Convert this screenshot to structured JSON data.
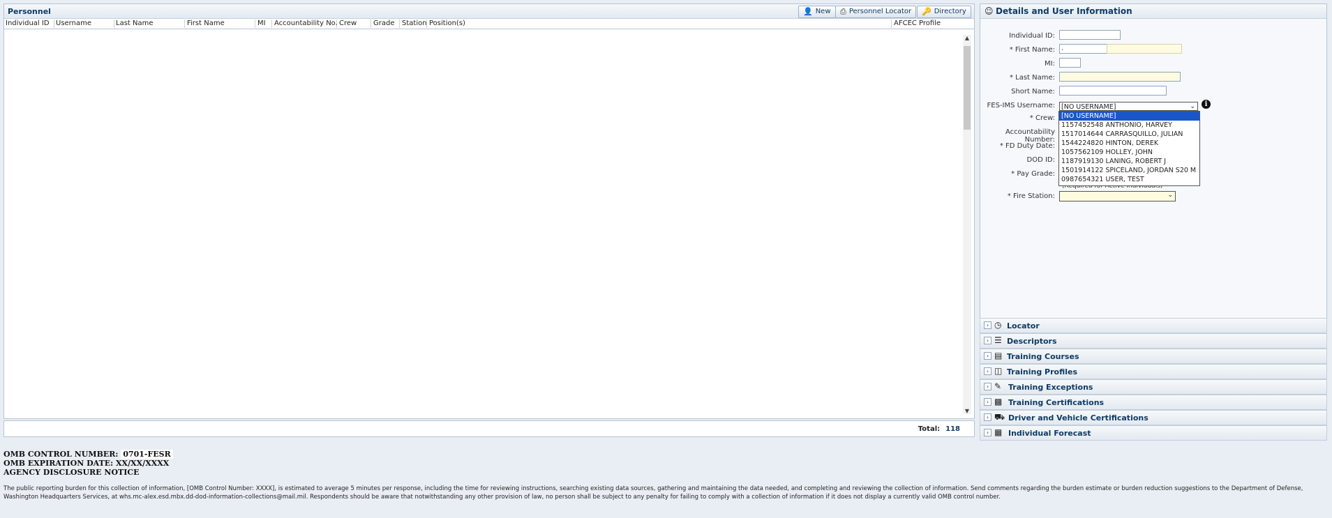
{
  "personnel": {
    "title": "Personnel",
    "buttons": {
      "new": "New",
      "locator": "Personnel Locator",
      "directory": "Directory"
    },
    "columns": [
      "Individual ID",
      "Username",
      "Last Name",
      "First Name",
      "MI",
      "Accountability No.",
      "Crew",
      "Grade",
      "Station",
      "Position(s)",
      "AFCEC Profile"
    ],
    "total_label": "Total:",
    "total_value": "118"
  },
  "omb": {
    "control_label": "OMB CONTROL NUMBER:",
    "control_value": "0701-FESR",
    "expiration": "OMB EXPIRATION DATE: XX/XX/XXXX",
    "notice_title": "AGENCY DISCLOSURE NOTICE",
    "notice_text": "The public reporting burden for this collection of information, [OMB Control Number: XXXX], is estimated to average 5 minutes per response, including the time for reviewing instructions, searching existing data sources, gathering and maintaining the data needed, and completing and reviewing the collection of information. Send comments regarding the burden estimate or burden reduction suggestions to the Department of Defense, Washington Headquarters Services, at whs.mc-alex.esd.mbx.dd-dod-information-collections@mail.mil. Respondents should be aware that notwithstanding any other provision of law, no person shall be subject to any penalty for failing to comply with a collection of information if it does not display a currently valid OMB control number."
  },
  "details": {
    "title": "Details and User Information",
    "fields": {
      "individual_id": "Individual ID:",
      "first_name": "* First Name:",
      "first_name_value": ".",
      "mi": "MI:",
      "last_name": "* Last Name:",
      "short_name": "Short Name:",
      "username": "FES-IMS Username:",
      "crew": "* Crew:",
      "accountability": "Accountability Number:",
      "fd_duty": "* FD Duty Date:",
      "dod_id": "DOD ID:",
      "pay_grade": "* Pay Grade:",
      "fire_station": "* Fire Station:"
    },
    "username_selected": "[NO USERNAME]",
    "username_options": [
      "[NO USERNAME]",
      "1157452548 ANTHONIO, HARVEY",
      "1517014644 CARRASQUILLO, JULIAN",
      "1544224820 HINTON, DEREK",
      "1057562109 HOLLEY, JOHN",
      "1187919130 LANING, ROBERT J",
      "1501914122 SPICELAND, JORDAN S20 M",
      "0987654321 USER, TEST"
    ],
    "required_note": "(Required for Active Individuals)"
  },
  "sections": [
    {
      "label": "Locator",
      "icon": "locator-icon"
    },
    {
      "label": "Descriptors",
      "icon": "list-icon"
    },
    {
      "label": "Training Courses",
      "icon": "book-icon"
    },
    {
      "label": "Training Profiles",
      "icon": "document-icon"
    },
    {
      "label": "Training Exceptions",
      "icon": "note-icon"
    },
    {
      "label": "Training Certifications",
      "icon": "certificate-icon"
    },
    {
      "label": "Driver and Vehicle Certifications",
      "icon": "vehicle-icon"
    },
    {
      "label": "Individual Forecast",
      "icon": "calendar-icon"
    }
  ]
}
